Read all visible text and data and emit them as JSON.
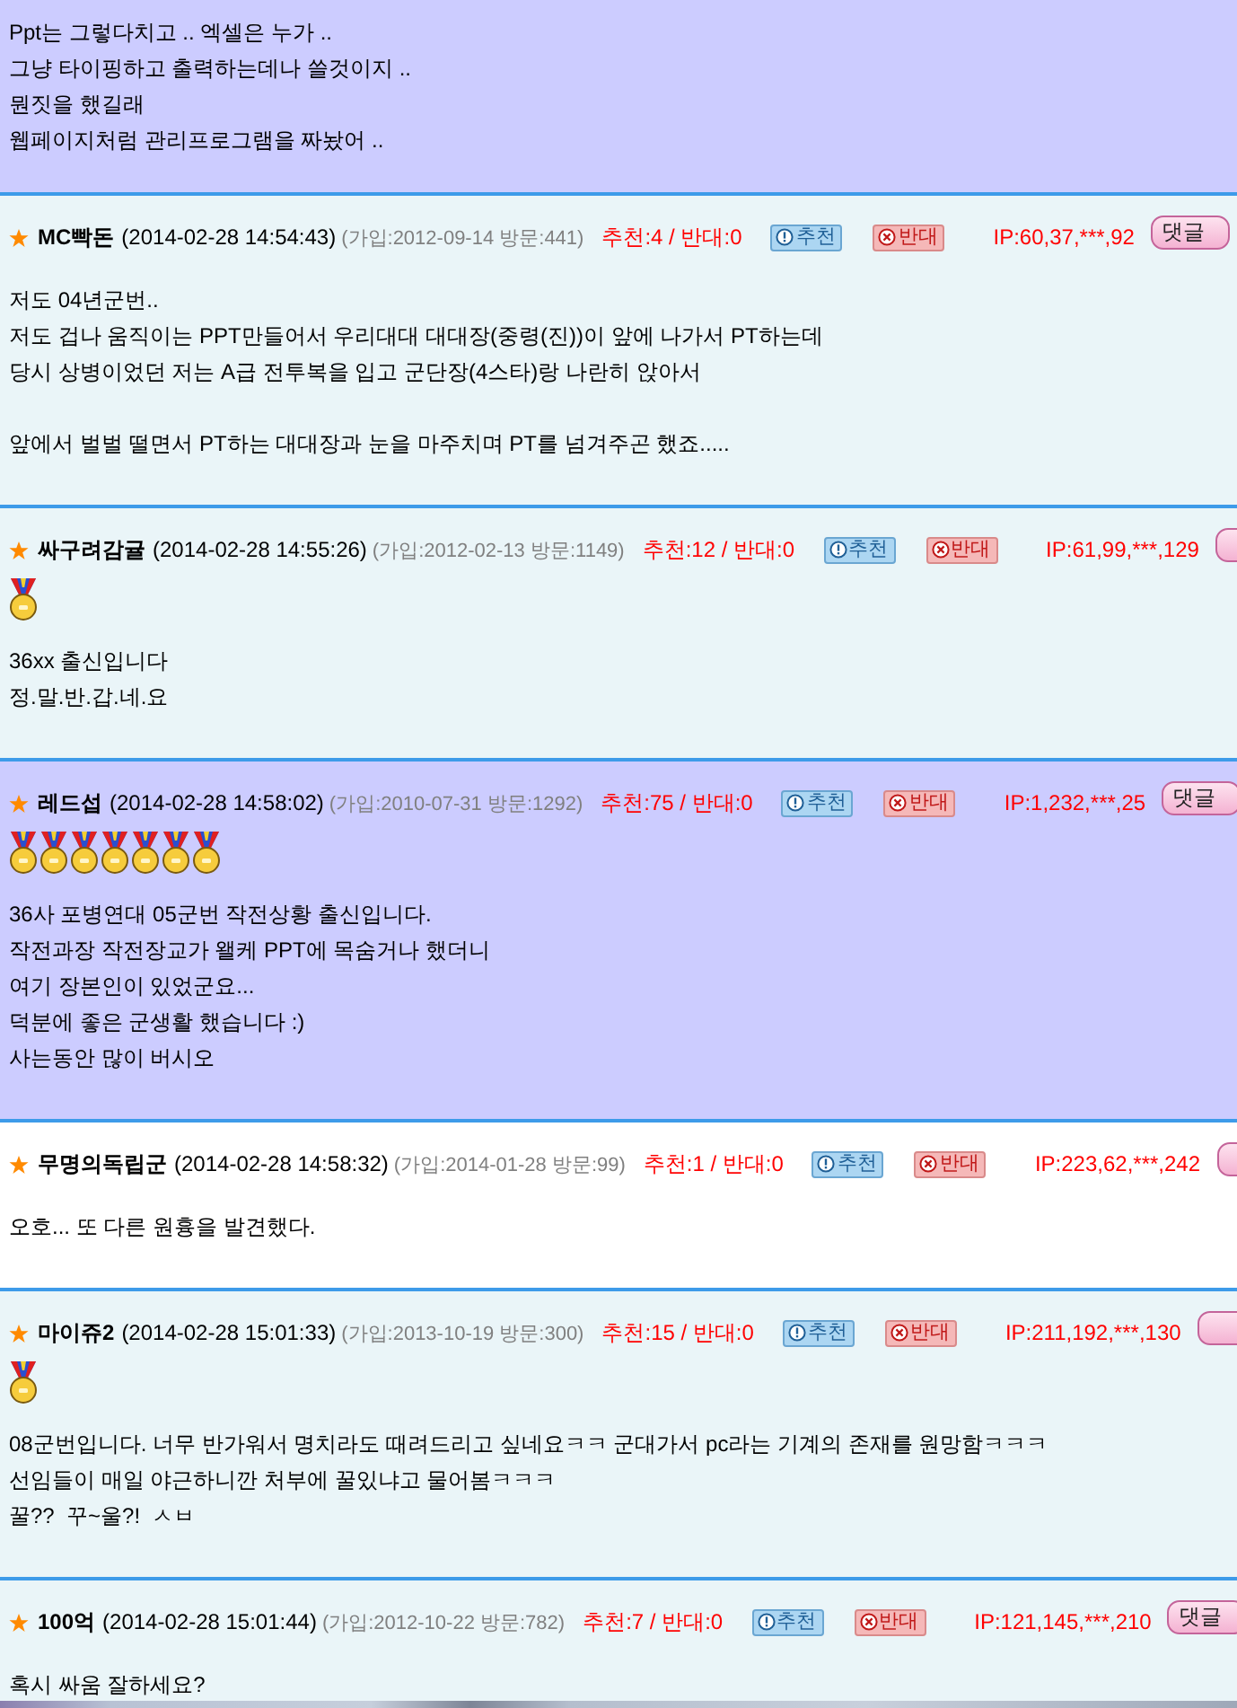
{
  "partial_comment": {
    "color": "#ccccff",
    "paragraphs": [
      "Ppt는 그렇다치고 .. 엑셀은 누가 ..\n그냥 타이핑하고 출력하는데나 쓸것이지 ..\n뭔짓을 했길래\n웹페이지처럼 관리프로그램을 짜놨어 .."
    ]
  },
  "comments": [
    {
      "color": "#eaf5f8",
      "name": "MC빡돈",
      "date": "(2014-02-28 14:54:43)",
      "join_info": "(가입:2012-09-14 방문:441)",
      "votes": "추천:4 / 반대:0",
      "recommend_button": "추천",
      "oppose_button": "반대",
      "ip": "IP:60,37,***,92",
      "reply_button": {
        "kind": "pill",
        "label": "댓글"
      },
      "paragraphs": [
        "저도 04년군번..\n저도 겁나 움직이는 PPT만들어서 우리대대 대대장(중령(진))이 앞에 나가서 PT하는데\n당시 상병이었던 저는 A급 전투복을 입고 군단장(4스타)랑 나란히 앉아서",
        "앞에서 벌벌 떨면서 PT하는 대대장과 눈을 마주치며 PT를 넘겨주곤 했죠....."
      ]
    },
    {
      "color": "#eaf5f8",
      "name": "싸구려감귤",
      "date": "(2014-02-28 14:55:26)",
      "join_info": "(가입:2012-02-13 방문:1149)",
      "votes": "추천:12 / 반대:0",
      "recommend_button": "추천",
      "oppose_button": "반대",
      "ip": "IP:61,99,***,129",
      "reply_button": {
        "kind": "pill"
      },
      "badges": [
        {
          "kind": "medal"
        }
      ],
      "paragraphs": [
        "36xx 출신입니다\n정.말.반.갑.네.요"
      ]
    },
    {
      "color": "#ccccff",
      "name": "레드섭",
      "date": "(2014-02-28 14:58:02)",
      "join_info": "(가입:2010-07-31 방문:1292)",
      "votes": "추천:75 / 반대:0",
      "recommend_button": "추천",
      "oppose_button": "반대",
      "ip": "IP:1,232,***,25",
      "reply_button": {
        "kind": "pill",
        "label": "댓글"
      },
      "badges": [
        {
          "kind": "medal"
        },
        {
          "kind": "medal"
        },
        {
          "kind": "medal"
        },
        {
          "kind": "medal"
        },
        {
          "kind": "medal"
        },
        {
          "kind": "medal"
        },
        {
          "kind": "medal"
        }
      ],
      "paragraphs": [
        "36사 포병연대 05군번 작전상황 출신입니다.\n작전과장 작전장교가 왤케 PPT에 목숨거나 했더니\n여기 장본인이 있었군요...\n덕분에 좋은 군생활 했습니다 :)\n사는동안 많이 버시오"
      ]
    },
    {
      "color": "#ffffff",
      "name": "무명의독립군",
      "date": "(2014-02-28 14:58:32)",
      "join_info": "(가입:2014-01-28 방문:99)",
      "votes": "추천:1 / 반대:0",
      "recommend_button": "추천",
      "oppose_button": "반대",
      "ip": "IP:223,62,***,242",
      "reply_button": {
        "kind": "pill"
      },
      "paragraphs": [
        "오호... 또 다른 원흉을 발견했다."
      ]
    },
    {
      "color": "#eaf5f8",
      "name": "마이쥬2",
      "date": "(2014-02-28 15:01:33)",
      "join_info": "(가입:2013-10-19 방문:300)",
      "votes": "추천:15 / 반대:0",
      "recommend_button": "추천",
      "oppose_button": "반대",
      "ip": "IP:211,192,***,130",
      "reply_button": {
        "kind": "pill"
      },
      "badges": [
        {
          "kind": "medal"
        }
      ],
      "paragraphs": [
        "08군번입니다. 너무 반가워서 명치라도 때려드리고 싶네요ㅋㅋ 군대가서 pc라는 기계의 존재를 원망함ㅋㅋㅋ\n선임들이 매일 야근하니깐 처부에 꿀있냐고 물어봄ㅋㅋㅋ\n꿀??  꾸~울?!  ㅅㅂ"
      ]
    },
    {
      "color": "#eaf5f8",
      "name": "100억",
      "date": "(2014-02-28 15:01:44)",
      "join_info": "(가입:2012-10-22 방문:782)",
      "votes": "추천:7 / 반대:0",
      "recommend_button": "추천",
      "oppose_button": "반대",
      "ip": "IP:121,145,***,210",
      "reply_button": {
        "kind": "pill",
        "label": "댓글"
      },
      "paragraphs": [
        "혹시 싸움 잘하세요?"
      ]
    }
  ],
  "bottom_strip": {
    "kind": "image"
  }
}
